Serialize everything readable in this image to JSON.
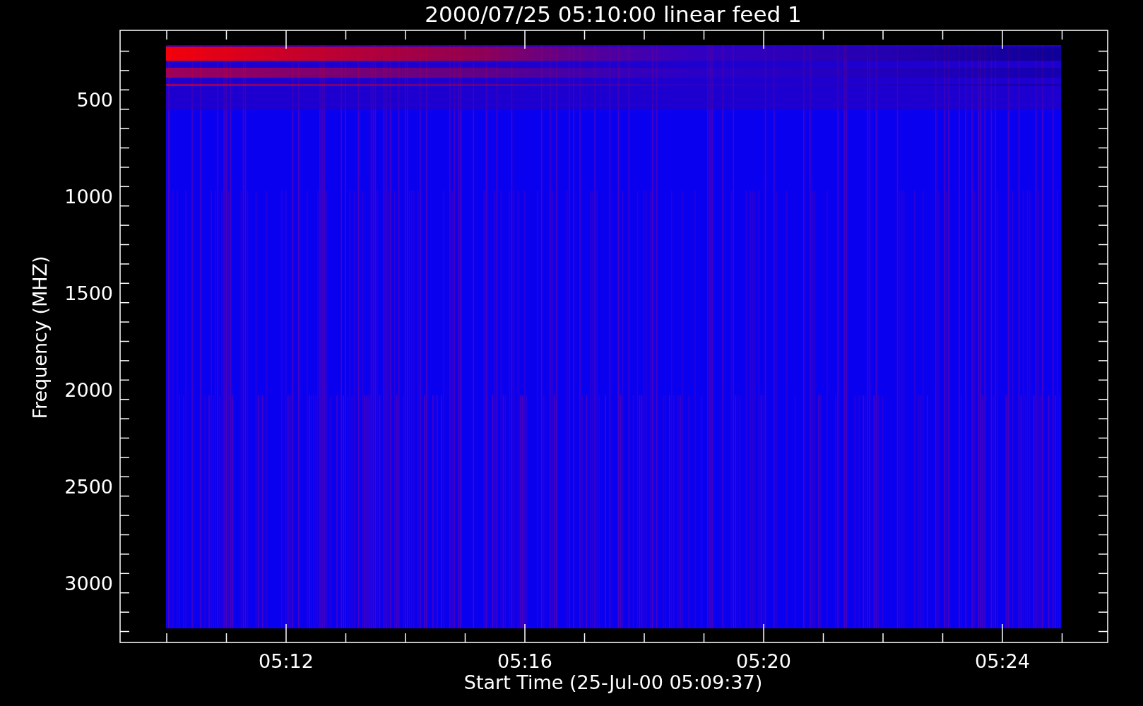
{
  "plot": {
    "title": "2000/07/25 05:10:00 linear feed 1",
    "y_axis": {
      "label": "Frequency (MHZ)",
      "ticks": [
        "500",
        "1000",
        "1500",
        "2000",
        "2500",
        "3000"
      ]
    },
    "x_axis": {
      "label": "Start Time (25-Jul-00 05:09:37)",
      "ticks": [
        "05:12",
        "05:16",
        "05:20",
        "05:24"
      ]
    }
  }
}
